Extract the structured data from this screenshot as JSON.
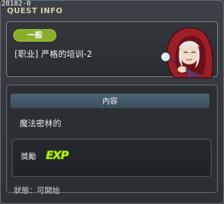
{
  "window": {
    "id_label": "28182-0",
    "title": "QUEST INFO"
  },
  "quest": {
    "category_badge": "一般",
    "name": "[职业] 严格的培训-2",
    "npc_icon": "red-hooded-npc-portrait"
  },
  "content": {
    "section_header": "內容",
    "description": "魔法密林的",
    "reward": {
      "label": "獎勵",
      "icon_name": "exp-icon",
      "icon_text": "EXP"
    },
    "status": "狀態：可開始"
  },
  "colors": {
    "badge": "#8aae2a",
    "title": "#d8d2a8",
    "section_header": "#4e6573",
    "exp": "#b6f21a"
  }
}
